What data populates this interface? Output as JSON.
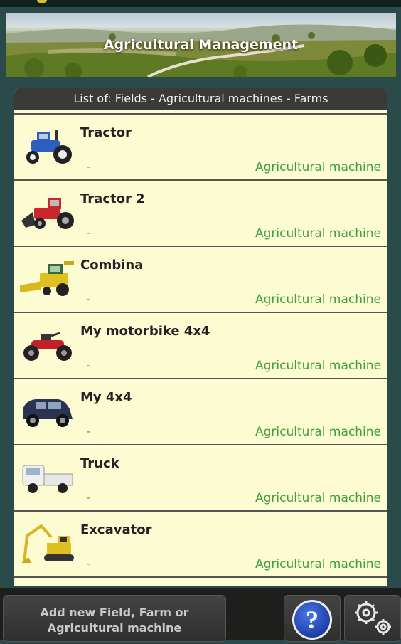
{
  "banner": {
    "title": "Agricultural Management"
  },
  "panel": {
    "header": "List of: Fields - Agricultural machines - Farms"
  },
  "items": [
    {
      "name": "Tractor",
      "detail": "-",
      "type": "Agricultural machine",
      "icon": "tractor-blue-icon"
    },
    {
      "name": "Tractor 2",
      "detail": "-",
      "type": "Agricultural machine",
      "icon": "tractor-red-icon"
    },
    {
      "name": "Combina",
      "detail": "-",
      "type": "Agricultural machine",
      "icon": "combine-harvester-icon"
    },
    {
      "name": "My motorbike 4x4",
      "detail": "-",
      "type": "Agricultural machine",
      "icon": "quad-bike-icon"
    },
    {
      "name": "My 4x4",
      "detail": "-",
      "type": "Agricultural machine",
      "icon": "suv-icon"
    },
    {
      "name": "Truck",
      "detail": "-",
      "type": "Agricultural machine",
      "icon": "pickup-truck-icon"
    },
    {
      "name": "Excavator",
      "detail": "-",
      "type": "Agricultural machine",
      "icon": "excavator-icon"
    }
  ],
  "footer": {
    "add_label": "Add new Field, Farm or Agricultural machine",
    "help_label": "?",
    "settings_icon": "gears-icon"
  },
  "colors": {
    "accent_green": "#3f9f3f",
    "panel_bg": "#fdfbd2",
    "app_bg": "#2b4a4a"
  }
}
